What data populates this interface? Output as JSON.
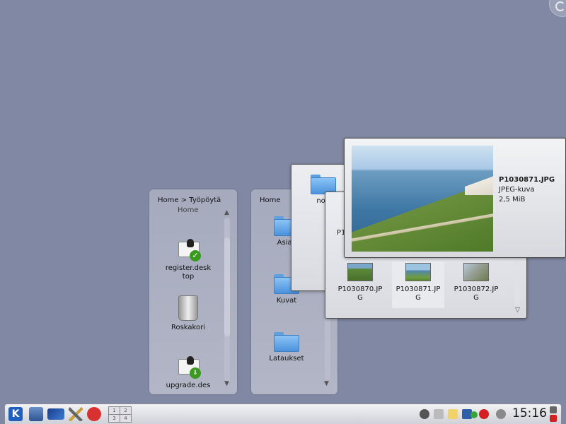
{
  "desktop_panel": {
    "breadcrumb": "Home > Työpöytä",
    "parent_label": "Home",
    "items": [
      {
        "label_lines": [
          "register.desk",
          "top"
        ]
      },
      {
        "label_lines": [
          "Roskakori"
        ]
      },
      {
        "label_lines": [
          "upgrade.des"
        ]
      }
    ]
  },
  "home_panel": {
    "title": "Home",
    "items": [
      "Asiak",
      "Kuvat",
      "Lataukset"
    ]
  },
  "folder_window": {
    "items": [
      "norj"
    ]
  },
  "pictures_window": {
    "partial_label": "P1",
    "items": [
      {
        "label_lines": [
          "P1030870.JP",
          "G"
        ]
      },
      {
        "label_lines": [
          "P1030871.JP",
          "G"
        ]
      },
      {
        "label_lines": [
          "P1030872.JP",
          "G"
        ]
      }
    ]
  },
  "preview_tooltip": {
    "filename": "P1030871.JPG",
    "type": "JPEG-kuva",
    "size": "2,5 MiB"
  },
  "taskbar": {
    "pager_desktops": [
      "1",
      "2",
      "3",
      "4"
    ],
    "clock": "15:16"
  }
}
